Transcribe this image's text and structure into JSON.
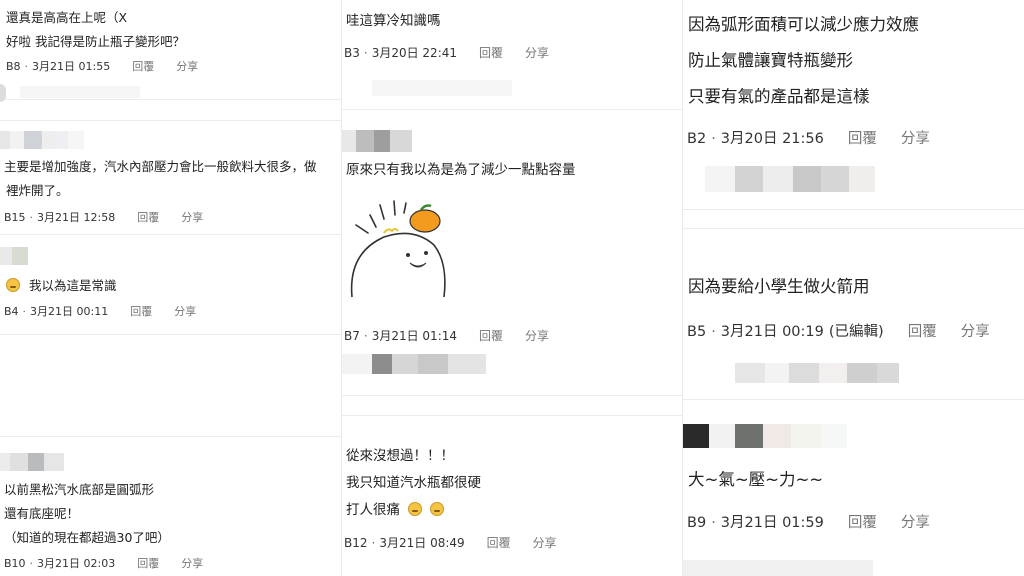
{
  "actions": {
    "reply": "回覆",
    "share": "分享"
  },
  "col1": [
    {
      "lines": [
        "還真是高高在上呢（X",
        "好啦 我記得是防止瓶子變形吧？"
      ],
      "floor": "B8",
      "time": "3月21日 01:55"
    },
    {
      "lines": [
        "主要是增加強度，汽水內部壓力會比一般飲料大很多，做",
        "裡炸開了。"
      ],
      "floor": "B15",
      "time": "3月21日 12:58"
    },
    {
      "lines": [
        "我以為這是常識"
      ],
      "floor": "B4",
      "time": "3月21日 00:11",
      "emoji": "thinking-face"
    },
    {
      "lines": [
        "以前黑松汽水底部是圓弧形",
        "還有底座呢！",
        "（知道的現在都超過30了吧）"
      ],
      "floor": "B10",
      "time": "3月21日 02:03"
    }
  ],
  "col2": [
    {
      "lines": [
        "哇這算冷知識嗎"
      ],
      "floor": "B3",
      "time": "3月20日 22:41"
    },
    {
      "lines": [
        "原來只有我以為是為了減少一點點容量"
      ],
      "floor": "B7",
      "time": "3月21日 01:14",
      "sticker": "duck-with-orange-sticker"
    },
    {
      "lines": [
        "從來沒想過！！！",
        "我只知道汽水瓶都很硬",
        "打人很痛"
      ],
      "floor": "B12",
      "time": "3月21日 08:49",
      "emoji": "laughing-face"
    }
  ],
  "col3": [
    {
      "lines": [
        "因為弧形面積可以減少應力效應",
        "防止氣體讓寶特瓶變形",
        "只要有氣的產品都是這樣"
      ],
      "floor": "B2",
      "time": "3月20日 21:56"
    },
    {
      "lines": [
        "因為要給小學生做火箭用"
      ],
      "floor": "B5",
      "time": "3月21日 00:19",
      "edited": "(已編輯)"
    },
    {
      "lines": [
        "大~氣~壓~力~~"
      ],
      "floor": "B9",
      "time": "3月21日 01:59"
    }
  ]
}
